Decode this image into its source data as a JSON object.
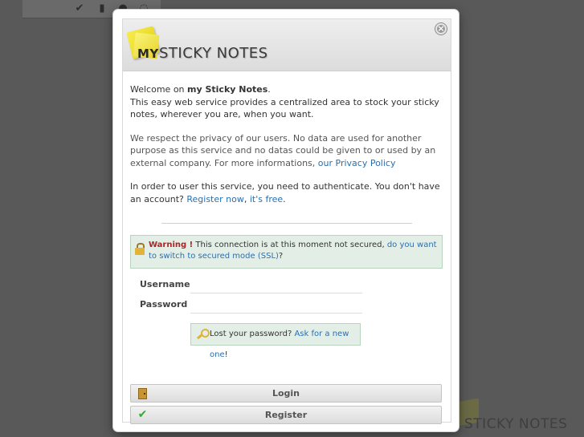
{
  "app": {
    "logo_my": "MY",
    "logo_sticky": "STICKY NOTES",
    "bg_logo_text": "STICKY NOTES"
  },
  "dialog": {
    "close_symbol": "×",
    "welcome_prefix": "Welcome on ",
    "welcome_brand": "my Sticky Notes",
    "welcome_suffix": ".",
    "intro": "This easy web service provides a centralized area to stock your sticky notes, wherever you are, when you want.",
    "privacy_text": "We respect the privacy of our users. No data are used for another purpose as this service and no datas could be given to or used by an external company. For more informations, ",
    "privacy_link": "our Privacy Policy",
    "auth_text": "In order to user this service, you need to authenticate. You don't have an account? ",
    "register_link": "Register now",
    "free_link": "it's free",
    "auth_end": ".",
    "warning_label": "Warning !",
    "warning_text": " This connection is at this moment not secured, ",
    "warning_link": "do you want to switch to secured mode (SSL)",
    "warning_end": "?",
    "username_label": "Username",
    "password_label": "Password",
    "username_value": "",
    "password_value": "",
    "lost_text": "Lost your password? ",
    "lost_link": "Ask for a new one",
    "lost_end": "!",
    "login_button": "Login",
    "register_button": "Register"
  },
  "icons": {
    "close": "close-icon",
    "lock": "lock-icon",
    "key": "key-icon",
    "login": "door-icon",
    "register": "checkmark-icon"
  },
  "colors": {
    "link": "#2a6fb0",
    "warning": "#b22222",
    "notice_bg": "#e3efe6"
  }
}
